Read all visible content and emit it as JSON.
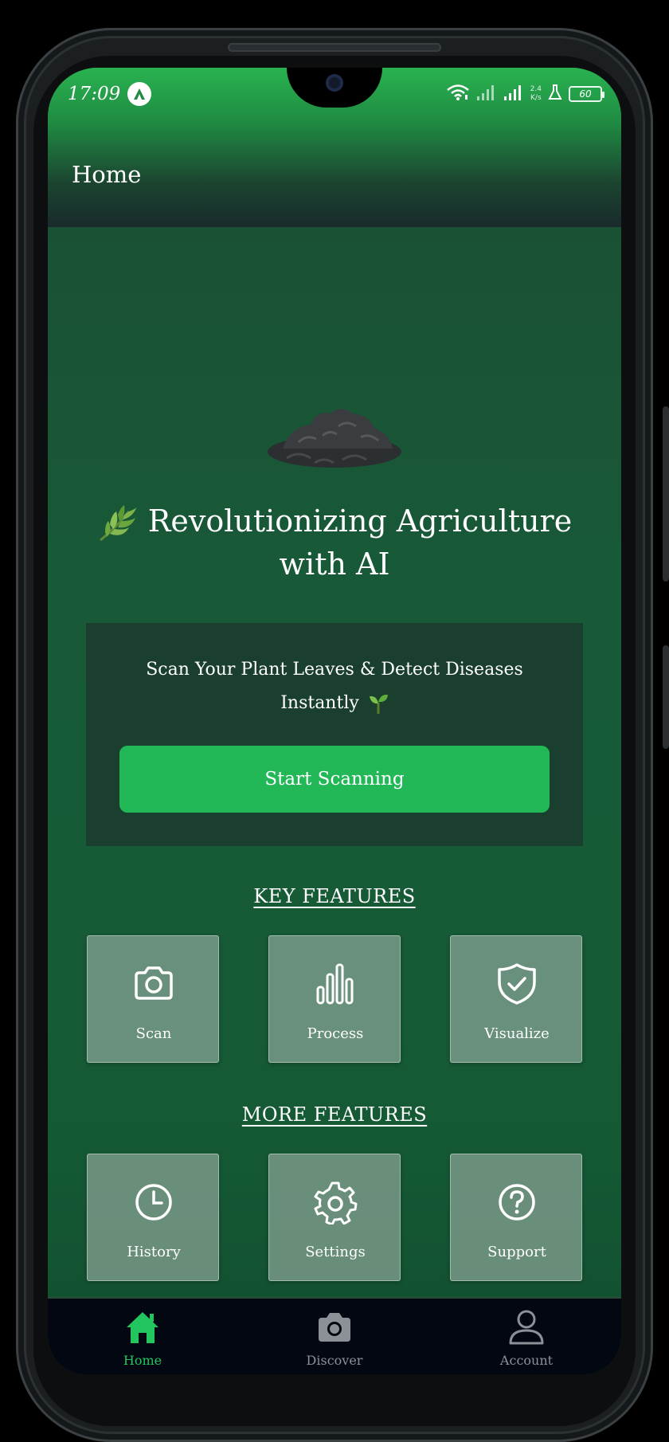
{
  "status_bar": {
    "time": "17:09",
    "net_speed_value": "2.4",
    "net_speed_unit": "K/s",
    "battery": "60"
  },
  "header": {
    "title": "Home"
  },
  "hero": {
    "title_line1": "Revolutionizing Agriculture",
    "title_line2": "with AI"
  },
  "scan_card": {
    "text_line1": "Scan Your Plant Leaves & Detect Diseases",
    "text_line2": "Instantly",
    "button_label": "Start Scanning"
  },
  "key_features": {
    "heading": "KEY FEATURES",
    "items": [
      {
        "label": "Scan",
        "icon": "camera-icon"
      },
      {
        "label": "Process",
        "icon": "bar-chart-icon"
      },
      {
        "label": "Visualize",
        "icon": "shield-check-icon"
      }
    ]
  },
  "more_features": {
    "heading": "MORE FEATURES",
    "items": [
      {
        "label": "History",
        "icon": "clock-icon"
      },
      {
        "label": "Settings",
        "icon": "gear-icon"
      },
      {
        "label": "Support",
        "icon": "help-circle-icon"
      }
    ]
  },
  "bottom_nav": {
    "items": [
      {
        "label": "Home",
        "icon": "home-icon",
        "active": true
      },
      {
        "label": "Discover",
        "icon": "camera-icon",
        "active": false
      },
      {
        "label": "Account",
        "icon": "user-icon",
        "active": false
      }
    ]
  },
  "colors": {
    "accent": "#22b858",
    "background": "#185a38",
    "card": "#1a3f2e",
    "nav_background": "#030712",
    "nav_active": "#22c55e",
    "nav_inactive": "#8b9197"
  }
}
